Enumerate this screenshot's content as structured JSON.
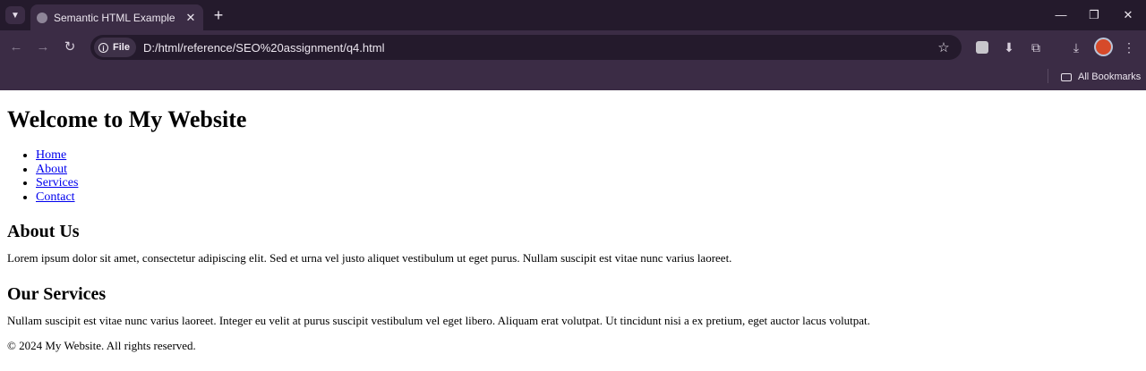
{
  "browser": {
    "tab_title": "Semantic HTML Example",
    "url_chip": "File",
    "url": "D:/html/reference/SEO%20assignment/q4.html",
    "bookmarks_folder": "All Bookmarks",
    "icons": {
      "tab_search": "chevron-down-icon",
      "favicon": "globe-icon",
      "close": "close-icon",
      "new_tab": "plus-icon",
      "back": "back-arrow-icon",
      "forward": "forward-arrow-icon",
      "reload": "reload-icon",
      "info": "info-icon",
      "bookmark": "star-icon",
      "extensions": "puzzle-icon",
      "downloads": "download-icon",
      "menu": "kebab-menu-icon"
    },
    "colors": {
      "tabstrip": "#241a2c",
      "toolbar": "#3b2c45"
    }
  },
  "page": {
    "heading": "Welcome to My Website",
    "nav": [
      "Home",
      "About",
      "Services",
      "Contact"
    ],
    "sections": [
      {
        "title": "About Us",
        "text": "Lorem ipsum dolor sit amet, consectetur adipiscing elit. Sed et urna vel justo aliquet vestibulum ut eget purus. Nullam suscipit est vitae nunc varius laoreet."
      },
      {
        "title": "Our Services",
        "text": "Nullam suscipit est vitae nunc varius laoreet. Integer eu velit at purus suscipit vestibulum vel eget libero. Aliquam erat volutpat. Ut tincidunt nisi a ex pretium, eget auctor lacus volutpat."
      }
    ],
    "footer": "© 2024 My Website. All rights reserved."
  }
}
